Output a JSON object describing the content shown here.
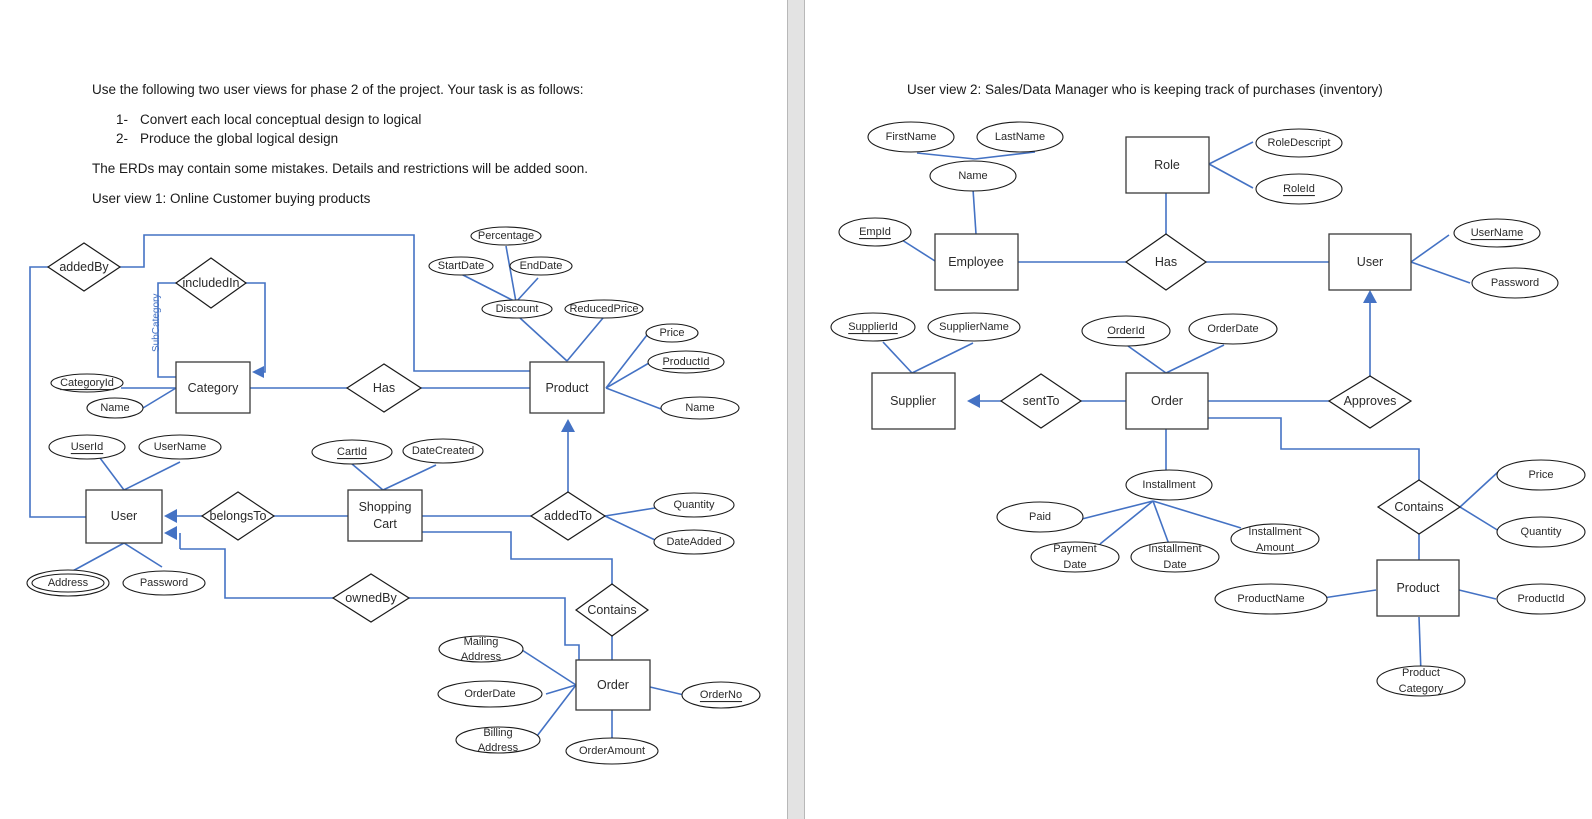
{
  "document": {
    "left_page": {
      "intro": "Use the following two user views for phase 2 of the project. Your task is as follows:",
      "tasks": [
        {
          "num": "1-",
          "text": "Convert each local conceptual design to logical"
        },
        {
          "num": "2-",
          "text": "Produce the global logical design"
        }
      ],
      "note": "The ERDs may contain some mistakes. Details and restrictions will be added soon.",
      "view_title": "User view 1: Online Customer buying products"
    },
    "right_page": {
      "view_title": "User view 2: Sales/Data Manager who is keeping track of purchases (inventory)"
    }
  },
  "colors": {
    "connector": "#4472c4",
    "outline": "#1a1a1a",
    "gutter": "#e3e3e3"
  },
  "erd1": {
    "entities": {
      "category": "Category",
      "product": "Product",
      "user": "User",
      "shopping_cart_line1": "Shopping",
      "shopping_cart_line2": "Cart",
      "order": "Order"
    },
    "relationships": {
      "added_by": "addedBy",
      "included_in": "includedIn",
      "has": "Has",
      "belongs_to": "belongsTo",
      "added_to": "addedTo",
      "owned_by": "ownedBy",
      "contains": "Contains"
    },
    "role_labels": {
      "sub_category": "SubCategory"
    },
    "attributes": {
      "category_id": "CategoryId",
      "category_name": "Name",
      "percentage": "Percentage",
      "start_date": "StartDate",
      "end_date": "EndDate",
      "discount": "Discount",
      "reduced_price": "ReducedPrice",
      "price": "Price",
      "product_id": "ProductId",
      "product_name": "Name",
      "user_id": "UserId",
      "user_name": "UserName",
      "address": "Address",
      "password": "Password",
      "cart_id": "CartId",
      "date_created": "DateCreated",
      "quantity": "Quantity",
      "date_added": "DateAdded",
      "mailing_address_line1": "Mailing",
      "mailing_address_line2": "Address",
      "order_date": "OrderDate",
      "billing_address_line1": "Billing",
      "billing_address_line2": "Address",
      "order_amount": "OrderAmount",
      "order_no": "OrderNo"
    }
  },
  "erd2": {
    "entities": {
      "role": "Role",
      "employee": "Employee",
      "user": "User",
      "supplier": "Supplier",
      "order": "Order",
      "product": "Product"
    },
    "relationships": {
      "has": "Has",
      "sent_to": "sentTo",
      "approves": "Approves",
      "contains": "Contains"
    },
    "attributes": {
      "first_name": "FirstName",
      "last_name": "LastName",
      "name": "Name",
      "role_descript": "RoleDescript",
      "role_id": "RoleId",
      "emp_id": "EmpId",
      "user_name": "UserName",
      "password": "Password",
      "supplier_id": "SupplierId",
      "supplier_name": "SupplierName",
      "order_id": "OrderId",
      "order_date": "OrderDate",
      "installment": "Installment",
      "paid": "Paid",
      "payment_date_line1": "Payment",
      "payment_date_line2": "Date",
      "installment_date_line1": "Installment",
      "installment_date_line2": "Date",
      "installment_amount_line1": "Installment",
      "installment_amount_line2": "Amount",
      "price": "Price",
      "quantity": "Quantity",
      "product_name": "ProductName",
      "product_id": "ProductId",
      "product_category_line1": "Product",
      "product_category_line2": "Category"
    }
  }
}
